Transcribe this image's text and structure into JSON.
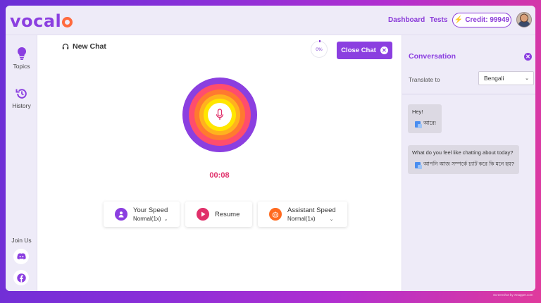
{
  "app": {
    "logo": "vocal",
    "nav": {
      "dashboard": "Dashboard",
      "tests": "Tests"
    },
    "credit": "Credit: 99949"
  },
  "sidebar": {
    "items": [
      {
        "label": "Topics",
        "icon": "lightbulb-icon"
      },
      {
        "label": "History",
        "icon": "history-icon"
      }
    ],
    "join_label": "Join Us",
    "social": [
      "discord-icon",
      "facebook-icon"
    ]
  },
  "main": {
    "chat_title": "New Chat",
    "progress": "0%",
    "close_label": "Close Chat",
    "timer": "00:08",
    "controls": {
      "your_speed": {
        "title": "Your Speed",
        "value": "Normal(1x)"
      },
      "resume": {
        "label": "Resume"
      },
      "assistant_speed": {
        "title": "Assistant Speed",
        "value": "Normal(1x)"
      }
    }
  },
  "conversation": {
    "title": "Conversation",
    "translate_label": "Translate to",
    "language": "Bengali",
    "messages": [
      {
        "text": "Hey!",
        "translation": "আরে!"
      },
      {
        "text": "What do you feel like chatting about today?",
        "translation": "আপনি আজ সম্পর্কে চ্যাট করে কি মনে হয়?"
      }
    ]
  },
  "colors": {
    "brand": "#8b3fe0",
    "timer": "#e0306a",
    "rings": [
      "#8b3fe0",
      "#ff4d6d",
      "#ff7a2f",
      "#ffb21e",
      "#ffe600"
    ]
  },
  "footer": {
    "watermark": "Screenshot by Xnapper.com"
  }
}
